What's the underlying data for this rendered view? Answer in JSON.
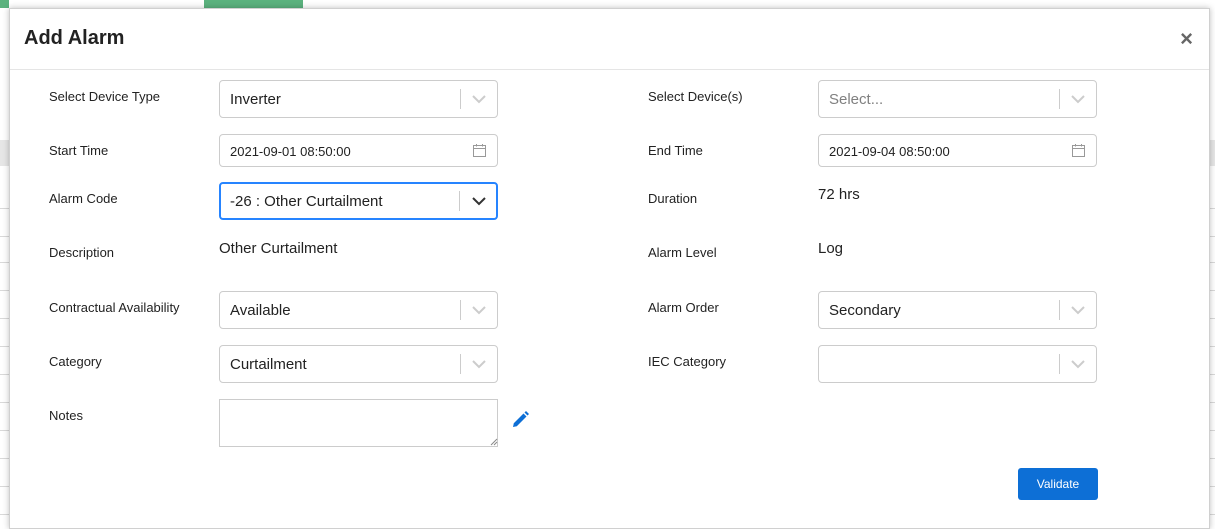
{
  "modal": {
    "title": "Add Alarm",
    "close_glyph": "×"
  },
  "fields": {
    "device_type": {
      "label": "Select Device Type",
      "value": "Inverter"
    },
    "devices": {
      "label": "Select Device(s)",
      "placeholder": "Select..."
    },
    "start_time": {
      "label": "Start Time",
      "value": "2021-09-01 08:50:00"
    },
    "end_time": {
      "label": "End Time",
      "value": "2021-09-04 08:50:00"
    },
    "alarm_code": {
      "label": "Alarm Code",
      "value": "-26 : Other Curtailment"
    },
    "duration": {
      "label": "Duration",
      "value": "72 hrs"
    },
    "description": {
      "label": "Description",
      "value": "Other Curtailment"
    },
    "alarm_level": {
      "label": "Alarm Level",
      "value": "Log"
    },
    "contractual_availability": {
      "label": "Contractual Availability",
      "value": "Available"
    },
    "alarm_order": {
      "label": "Alarm Order",
      "value": "Secondary"
    },
    "category": {
      "label": "Category",
      "value": "Curtailment"
    },
    "iec_category": {
      "label": "IEC Category",
      "value": ""
    },
    "notes": {
      "label": "Notes",
      "value": ""
    }
  },
  "buttons": {
    "validate": "Validate"
  },
  "icons": {
    "chevron": "chevron-down-icon",
    "calendar": "calendar-icon",
    "pencil": "pencil-icon",
    "close": "close-icon"
  },
  "colors": {
    "primary": "#0d6fd6",
    "focus": "#2684ff",
    "tab_green": "#5bb27e"
  }
}
